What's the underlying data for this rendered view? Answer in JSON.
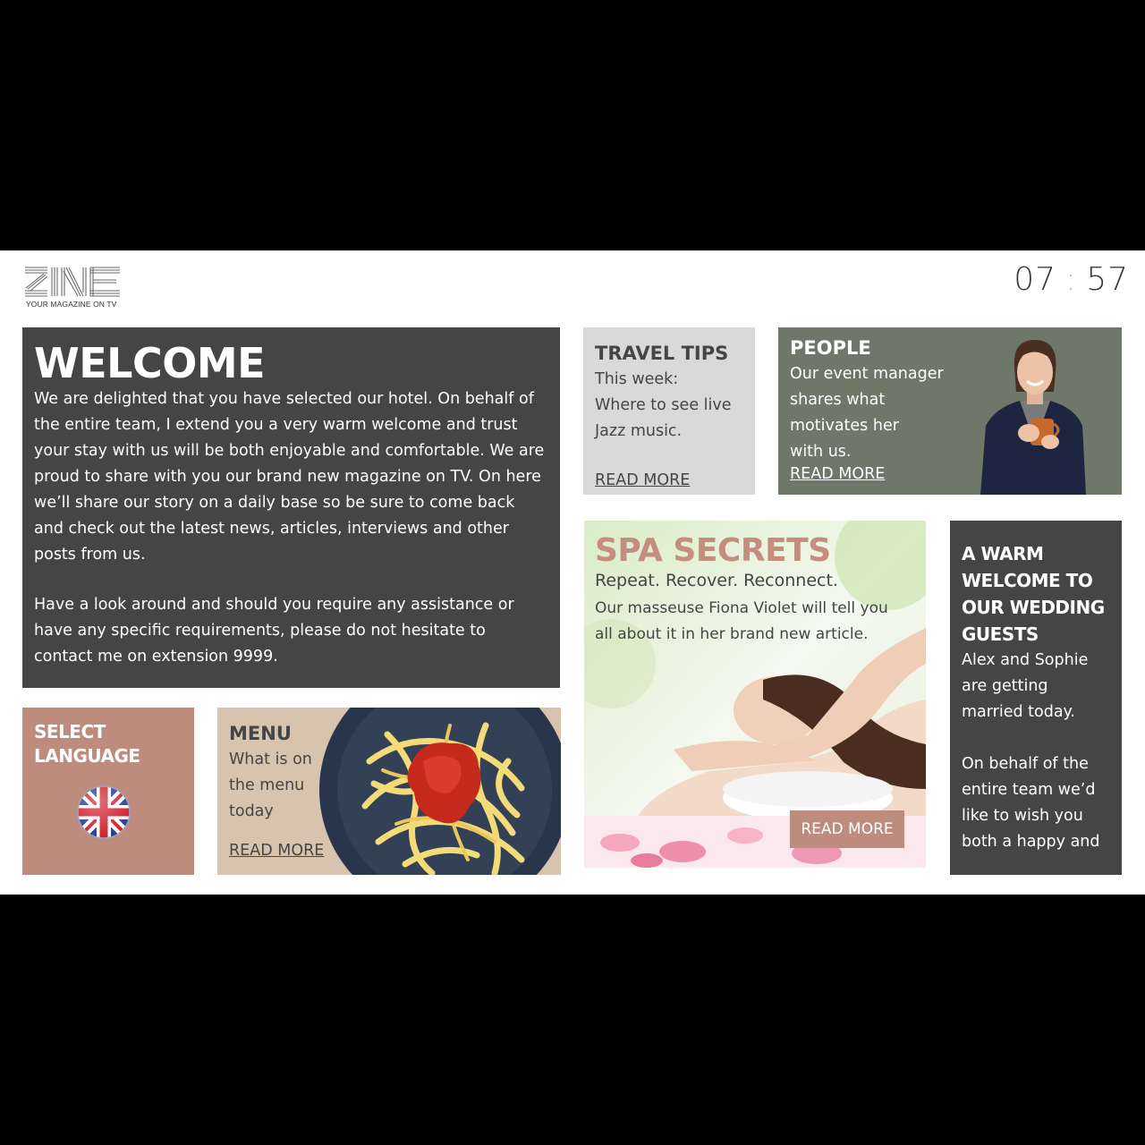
{
  "header": {
    "logo_text": "ZINE",
    "logo_tagline": "YOUR MAGAZINE ON TV",
    "clock_hours": "07",
    "clock_separator": ":",
    "clock_minutes": "57"
  },
  "welcome": {
    "title": "WELCOME",
    "paragraph1": "We are delighted that you have selected our hotel. On behalf of the entire team, I extend you a very warm welcome and trust your stay with us will be both enjoyable and comfortable.  We are proud to share with you our brand new magazine on TV. On here we’ll share our story on a daily base so be sure to come back and check out the latest news, articles, interviews and other posts from us.",
    "paragraph2": "Have a look around and should you require any assistance or have any specific requirements, please do not hesitate to contact me on extension 9999."
  },
  "travel": {
    "title": "TRAVEL TIPS",
    "line1": "This week:",
    "line2": "Where to see live",
    "line3": "Jazz music.",
    "read_more": "READ MORE"
  },
  "people": {
    "title": "PEOPLE",
    "line1": "Our event manager",
    "line2": "shares what",
    "line3": "motivates her",
    "line4": "with us.",
    "read_more": "READ MORE"
  },
  "spa": {
    "title": "SPA SECRETS",
    "subtitle": "Repeat. Recover. Reconnect.",
    "line1": "Our masseuse Fiona Violet will tell you",
    "line2": "all about it in her brand new article.",
    "read_more": "READ MORE"
  },
  "wedding": {
    "title1": "A WARM",
    "title2": "WELCOME TO",
    "title3": "OUR WEDDING",
    "title4": "GUESTS",
    "line1": "Alex and Sophie",
    "line2": "are getting",
    "line3": "married today.",
    "line4": "On behalf of the",
    "line5": "entire team we’d",
    "line6": "like to wish you",
    "line7": "both a happy and"
  },
  "language": {
    "title1": "SELECT",
    "title2": "LANGUAGE",
    "flag_icon": "uk-flag-icon"
  },
  "menu": {
    "title": "MENU",
    "line1": "What is on",
    "line2": "the menu",
    "line3": "today",
    "read_more": "READ MORE"
  },
  "colors": {
    "dark_tile": "#454545",
    "light_tile": "#d9d9d9",
    "people_tile": "#6f7768",
    "language_tile": "#bd8c7d",
    "menu_tile": "#d8c4ae",
    "spa_title": "#c48d7e"
  }
}
